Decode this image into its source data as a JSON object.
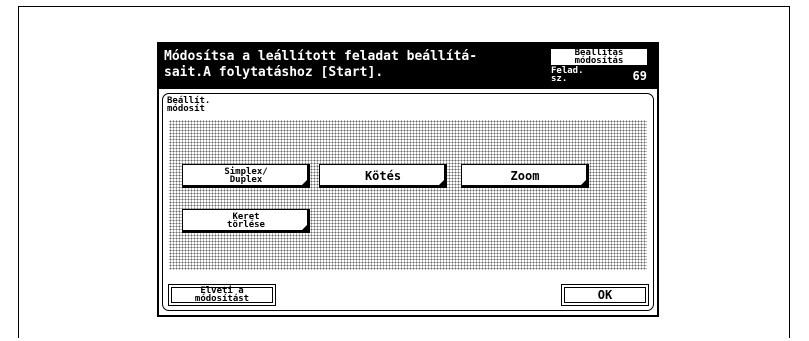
{
  "header": {
    "message": "Módosítsa a leállított feladat beállítá-\nsait.A folytatáshoz [Start].",
    "mode": "Beállítás\nmódosítás",
    "job_number_label": "Felad.\nsz.",
    "job_number": "69"
  },
  "panel": {
    "title": "Beállít.\nmódosít"
  },
  "buttons": {
    "simplex_duplex": "Simplex/\nDuplex",
    "binding": "Kötés",
    "zoom": "Zoom",
    "erase_frame": "Keret\ntörlése"
  },
  "footer": {
    "discard": "Elveti a\nmódosítást",
    "ok": "OK"
  }
}
